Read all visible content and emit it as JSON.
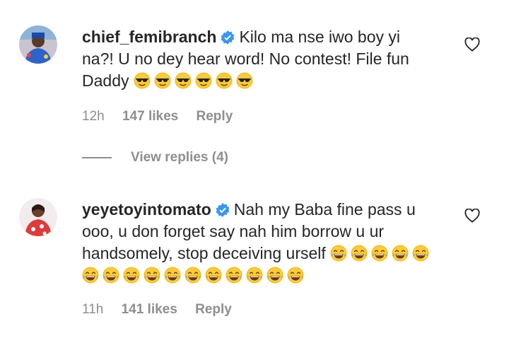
{
  "comments": [
    {
      "username": "chief_femibranch",
      "text": "Kilo ma nse iwo boy yi na?! U no dey hear word! No contest! File fun Daddy",
      "emojis": "sunglasses",
      "emoji_count": 6,
      "time": "12h",
      "likes": "147 likes",
      "reply": "Reply"
    },
    {
      "username": "yeyetoyintomato",
      "text": "Nah my Baba fine pass u ooo, u don forget say nah him borrow u ur handsomely, stop deceiving urself",
      "emojis": "laughing",
      "emoji_count": 16,
      "time": "11h",
      "likes": "141 likes",
      "reply": "Reply"
    }
  ],
  "view_replies": "View replies (4)",
  "icons": {
    "verified": "verified-badge-icon",
    "heart": "heart-outline-icon"
  },
  "colors": {
    "text": "#262626",
    "muted": "#8e8e8e",
    "verified": "#3897f0"
  }
}
